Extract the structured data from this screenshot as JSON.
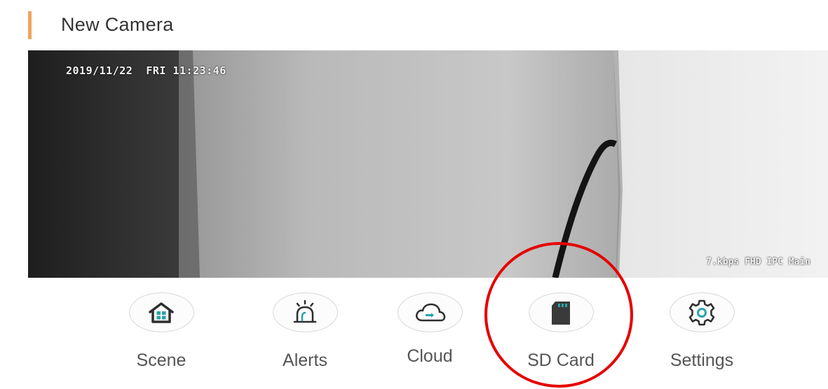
{
  "header": {
    "title": "New Camera"
  },
  "video": {
    "timestamp": "2019/11/22  FRI 11:23:46",
    "stream_info": "7.kbps FHD IPC Main"
  },
  "toolbar": {
    "items": [
      {
        "label": "Scene",
        "icon": "home-icon"
      },
      {
        "label": "Alerts",
        "icon": "alarm-icon"
      },
      {
        "label": "Cloud",
        "icon": "cloud-icon"
      },
      {
        "label": "SD Card",
        "icon": "sd-card-icon"
      },
      {
        "label": "Settings",
        "icon": "gear-icon"
      }
    ]
  },
  "colors": {
    "accent": "#f0a45f",
    "icon_dark": "#2d2d2d",
    "icon_teal": "#2aa3a8",
    "highlight": "#e60000"
  }
}
